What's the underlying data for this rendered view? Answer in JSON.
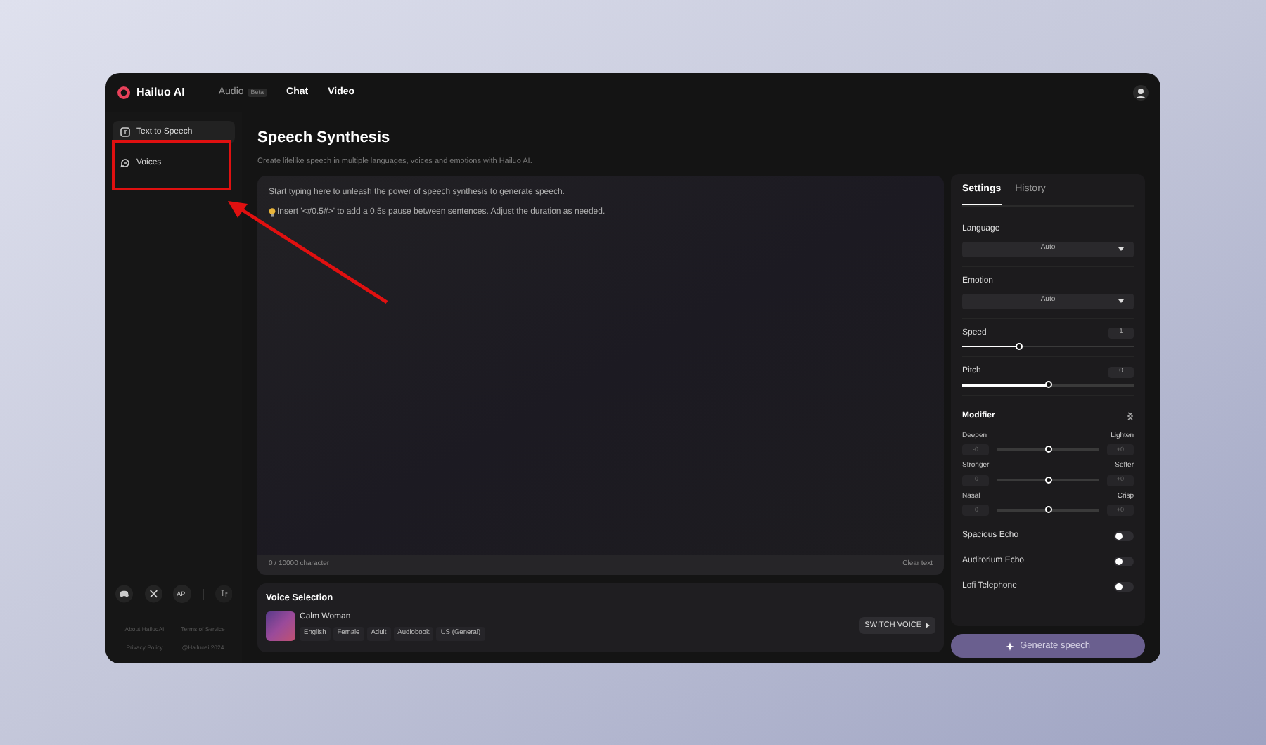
{
  "brand": "Hailuo AI",
  "nav": [
    {
      "label": "Audio",
      "badge": "Beta",
      "selected": true
    },
    {
      "label": "Chat",
      "selected": false
    },
    {
      "label": "Video",
      "selected": false
    }
  ],
  "sidebar": {
    "items": [
      {
        "label": "Text to Speech",
        "selected": true
      },
      {
        "label": "Voices",
        "selected": false
      }
    ],
    "social": [
      "API"
    ],
    "footer_links": [
      "About HailuoAI",
      "Terms of Service",
      "Privacy Policy",
      "@Hailuoai 2024"
    ]
  },
  "page": {
    "title": "Speech Synthesis",
    "subtitle": "Create lifelike speech in multiple languages, voices and emotions with Hailuo AI."
  },
  "editor": {
    "placeholder": "Start typing here to unleash the power of speech synthesis to generate speech.",
    "hint": "Insert '<#0.5#>' to add a 0.5s pause between sentences. Adjust the duration as needed.",
    "counter": "0 / 10000 character",
    "clear": "Clear text"
  },
  "voice_selection": {
    "title": "Voice Selection",
    "name": "Calm Woman",
    "tags": [
      "English",
      "Female",
      "Adult",
      "Audiobook",
      "US (General)"
    ],
    "button": "SWITCH VOICE"
  },
  "settings": {
    "tabs": [
      {
        "label": "Settings",
        "selected": true
      },
      {
        "label": "History",
        "selected": false
      }
    ],
    "controls": [
      {
        "kind": "select",
        "label": "Language",
        "value": "Auto"
      },
      {
        "kind": "select",
        "label": "Emotion",
        "value": "Auto"
      },
      {
        "kind": "slider",
        "label": "Speed",
        "reading": "1",
        "level": 0.33
      },
      {
        "kind": "slider",
        "label": "Pitch",
        "reading": "0",
        "level": 0.5
      }
    ],
    "modifier": {
      "title": "Modifier",
      "rows": [
        {
          "left": "Deepen",
          "right": "Lighten",
          "left_value": "-0",
          "right_value": "+0",
          "level": 0.5
        },
        {
          "left": "Stronger",
          "right": "Softer",
          "left_value": "-0",
          "right_value": "+0",
          "level": 0.5
        },
        {
          "left": "Nasal",
          "right": "Crisp",
          "left_value": "-0",
          "right_value": "+0",
          "level": 0.5
        }
      ]
    },
    "effects": [
      {
        "label": "Spacious Echo",
        "on": false
      },
      {
        "label": "Auditorium Echo",
        "on": false
      },
      {
        "label": "Lofi Telephone",
        "on": false
      }
    ]
  },
  "generate": "Generate speech"
}
